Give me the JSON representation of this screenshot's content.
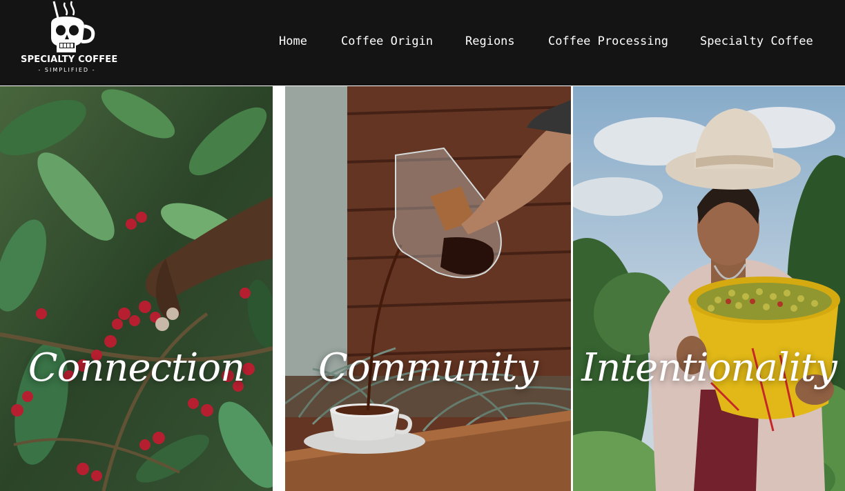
{
  "header": {
    "logo": {
      "title": "SPECIALTY COFFEE",
      "subtitle": "- SIMPLIFIED -",
      "icon": "skull-coffee-cup-icon"
    },
    "nav": [
      {
        "label": "Home"
      },
      {
        "label": "Coffee Origin"
      },
      {
        "label": "Regions"
      },
      {
        "label": "Coffee Processing"
      },
      {
        "label": "Specialty Coffee"
      }
    ]
  },
  "panels": [
    {
      "title": "Connection",
      "image": "hand picking ripe coffee cherries"
    },
    {
      "title": "Community",
      "image": "pouring coffee from glass carafe into cup"
    },
    {
      "title": "Intentionality",
      "image": "farmer holding a bucket of coffee cherries"
    }
  ],
  "colors": {
    "header_bg": "#141414",
    "text": "#ffffff"
  }
}
